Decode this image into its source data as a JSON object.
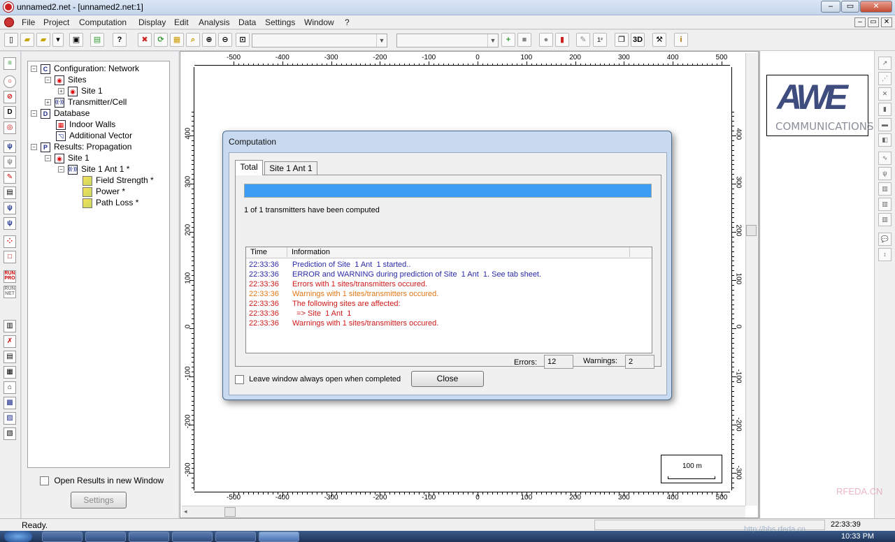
{
  "window": {
    "title": "unnamed2.net - [unnamed2.net:1]",
    "min": "–",
    "restore": "▭",
    "close": "✕"
  },
  "menu": [
    "File",
    "Project",
    "Computation",
    "Display",
    "Edit",
    "Analysis",
    "Data",
    "Settings",
    "Window",
    "?"
  ],
  "tree": [
    {
      "label": "Configuration: Network",
      "icon": "C"
    },
    {
      "label": "Sites",
      "icon": "O"
    },
    {
      "label": "Site  1",
      "icon": "O"
    },
    {
      "label": "Transmitter/Cell",
      "icon": "((·))"
    },
    {
      "label": "Database",
      "icon": "D"
    },
    {
      "label": "Indoor Walls",
      "icon": "▦"
    },
    {
      "label": "Additional Vector",
      "icon": "◹"
    },
    {
      "label": "Results: Propagation",
      "icon": "P"
    },
    {
      "label": "Site  1",
      "icon": "O"
    },
    {
      "label": "Site  1 Ant  1 *",
      "icon": "((·))"
    },
    {
      "label": "Field Strength *",
      "icon": ""
    },
    {
      "label": "Power *",
      "icon": ""
    },
    {
      "label": "Path Loss *",
      "icon": ""
    }
  ],
  "open_results_label": "Open Results in new Window",
  "settings_button": "Settings",
  "ruler": {
    "x_ticks": [
      "-500",
      "-400",
      "-300",
      "-200",
      "-100",
      "0",
      "100",
      "200",
      "300",
      "400",
      "500"
    ],
    "y_ticks": [
      "400",
      "300",
      "200",
      "100",
      "0",
      "-100",
      "-200",
      "-300"
    ]
  },
  "scale_bar": "100 m",
  "logo": {
    "main": "AWE",
    "sub": "COMMUNICATIONS"
  },
  "dialog": {
    "title": "Computation",
    "tabs": [
      "Total",
      "Site  1 Ant  1"
    ],
    "progress": 1.0,
    "progress_text": "1 of 1 transmitters have been computed",
    "col_time": "Time",
    "col_info": "Information",
    "rows": [
      {
        "time": "22:33:36",
        "msg": "Prediction of Site  1 Ant  1 started..",
        "color": "#2a2aa8"
      },
      {
        "time": "22:33:36",
        "msg": "ERROR and WARNING during prediction of Site  1 Ant  1. See tab sheet.",
        "color": "#2a2aa8"
      },
      {
        "time": "22:33:36",
        "msg": "Errors with 1 sites/transmitters occured.",
        "color": "#d01818"
      },
      {
        "time": "22:33:36",
        "msg": "Warnings with 1 sites/transmitters occured.",
        "color": "#e07818"
      },
      {
        "time": "22:33:36",
        "msg": "The following sites are affected:",
        "color": "#d01818"
      },
      {
        "time": "22:33:36",
        "msg": "  => Site  1 Ant  1",
        "color": "#d01818"
      },
      {
        "time": "22:33:36",
        "msg": "Warnings with 1 sites/transmitters occured.",
        "color": "#d01818"
      }
    ],
    "errors_label": "Errors:",
    "errors_value": "12",
    "warnings_label": "Warnings:",
    "warnings_value": "2",
    "leave_open_label": "Leave window always open when completed",
    "close_button": "Close"
  },
  "status": {
    "text": "Ready.",
    "clock": "22:33:39"
  },
  "taskbar": {
    "time": "10:33 PM"
  },
  "watermark": {
    "site": "RFEDA.CN",
    "url": "http://bbs.rfeda.cn"
  },
  "colors": {
    "progress": "#3d9df5",
    "accent": "#1a2a8a"
  }
}
